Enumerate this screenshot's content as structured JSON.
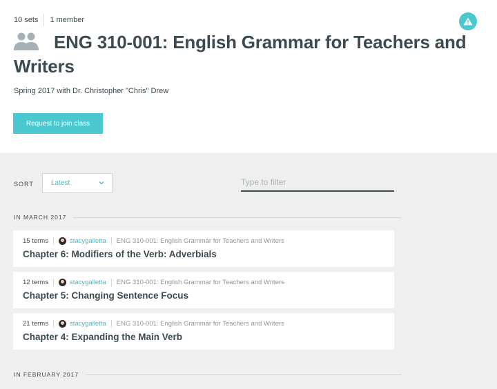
{
  "header": {
    "sets_count": "10 sets",
    "members_count": "1 member",
    "title": "ENG 310-001: English Grammar for Teachers and Writers",
    "subtitle": "Spring 2017 with Dr. Christopher \"Chris\" Drew",
    "join_button": "Request to join class",
    "class_icon": "people-icon",
    "alert_icon": "warning-icon"
  },
  "controls": {
    "sort_label": "SORT",
    "sort_value": "Latest",
    "filter_placeholder": "Type to filter"
  },
  "groups": [
    {
      "heading": "IN MARCH 2017",
      "sets": [
        {
          "terms": "15 terms",
          "user": "stacygalletta",
          "class_name": "ENG 310-001: English Grammar for Teachers and Writers",
          "title": "Chapter 6: Modifiers of the Verb: Adverbials"
        },
        {
          "terms": "12 terms",
          "user": "stacygalletta",
          "class_name": "ENG 310-001: English Grammar for Teachers and Writers",
          "title": "Chapter 5: Changing Sentence Focus"
        },
        {
          "terms": "21 terms",
          "user": "stacygalletta",
          "class_name": "ENG 310-001: English Grammar for Teachers and Writers",
          "title": "Chapter 4: Expanding the Main Verb"
        }
      ]
    },
    {
      "heading": "IN FEBRUARY 2017",
      "sets": []
    }
  ],
  "colors": {
    "accent": "#4bc8cf",
    "text": "#3d4b51",
    "background": "#efefef"
  }
}
